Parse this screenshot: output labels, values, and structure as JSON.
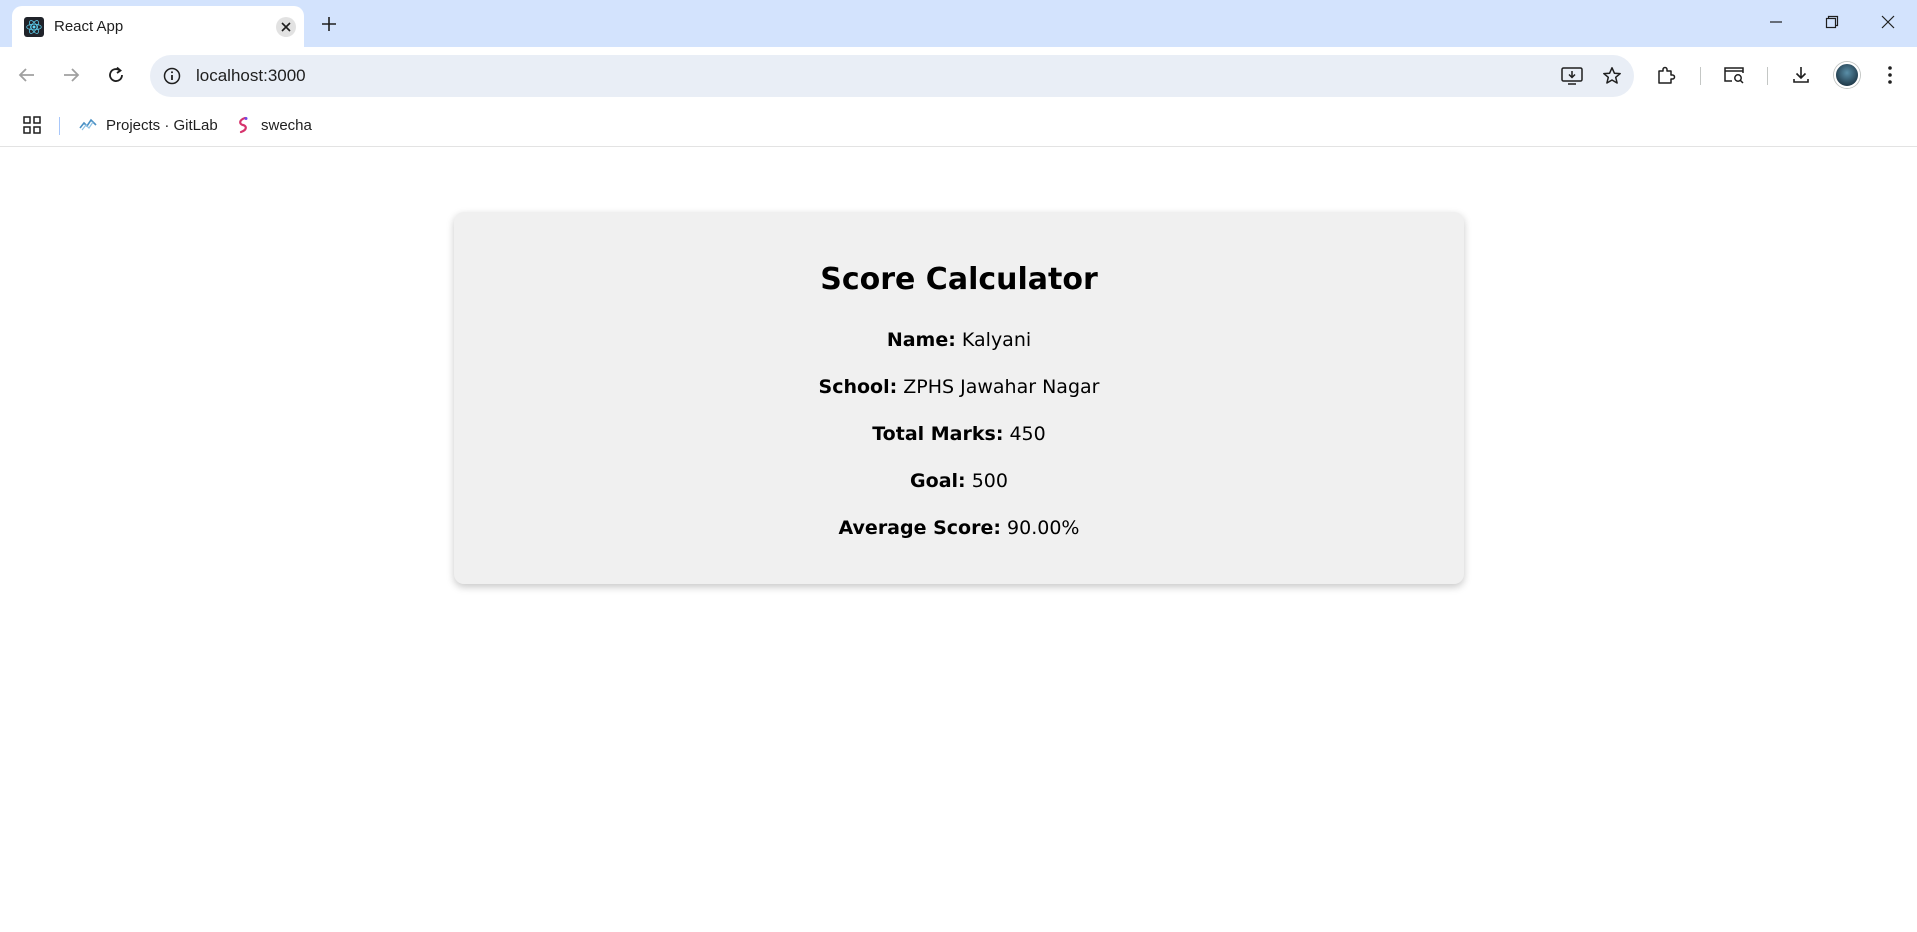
{
  "browser": {
    "tab": {
      "title": "React App",
      "favicon": "react-icon"
    },
    "new_tab_icon": "plus-icon",
    "window_controls": [
      "minimize-icon",
      "restore-icon",
      "close-icon"
    ],
    "address": {
      "url": "localhost:3000"
    },
    "bookmarks": [
      {
        "label": "Projects · GitLab",
        "icon": "gitlab-icon"
      },
      {
        "label": "swecha",
        "icon": "swecha-icon"
      }
    ]
  },
  "card": {
    "title": "Score Calculator",
    "fields": [
      {
        "label": "Name:",
        "value": "Kalyani"
      },
      {
        "label": "School:",
        "value": "ZPHS Jawahar Nagar"
      },
      {
        "label": "Total Marks:",
        "value": "450"
      },
      {
        "label": "Goal:",
        "value": "500"
      },
      {
        "label": "Average Score:",
        "value": "90.00%"
      }
    ]
  },
  "colors": {
    "tabstrip": "#d3e3fd",
    "omnibox": "#e9eef6",
    "card_background": "#f0f0f0"
  }
}
